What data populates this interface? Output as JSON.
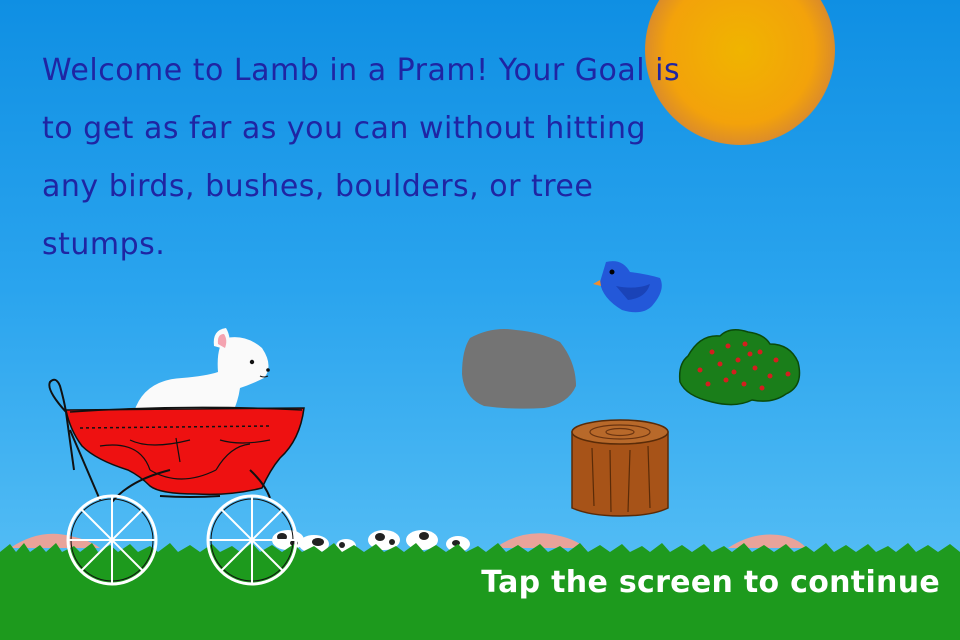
{
  "intro": {
    "message": "Welcome to Lamb in a Pram! Your Goal is to get as far as you can without hitting any birds, bushes, boulders, or tree stumps."
  },
  "prompt": {
    "continue_label": "Tap the screen to continue"
  },
  "colors": {
    "sky": "#2aa4ee",
    "grass": "#1f9a1f",
    "intro_text": "#1f25a3",
    "pram": "#ee1111",
    "sun": "#f0a800"
  },
  "icons": {
    "sun": "sun-icon",
    "bird": "bird-icon",
    "boulder": "boulder-icon",
    "bush": "bush-icon",
    "stump": "tree-stump-icon",
    "lamb": "lamb-icon",
    "pram": "pram-icon",
    "cows": "cow-icon"
  }
}
